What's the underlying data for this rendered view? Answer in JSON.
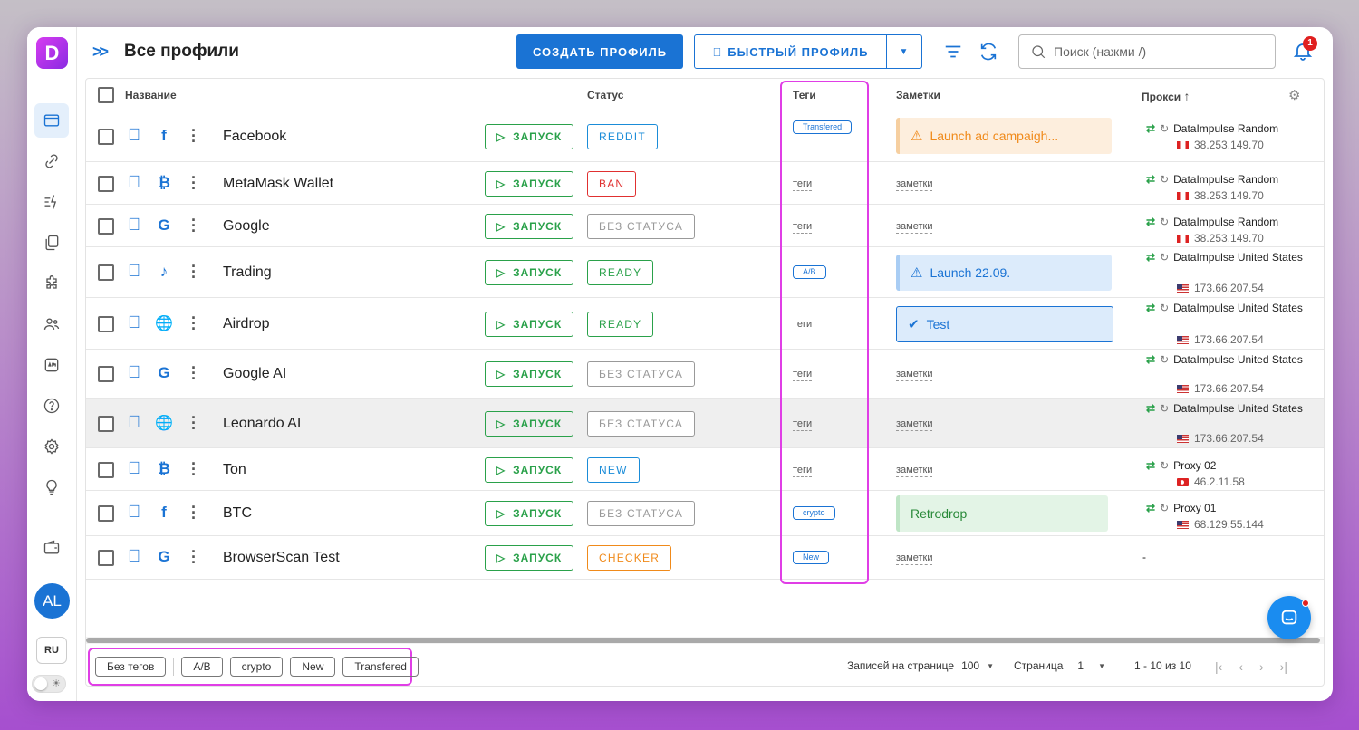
{
  "app": {
    "logo_letter": "D"
  },
  "header": {
    "title": "Все профили",
    "create_label": "СОЗДАТЬ ПРОФИЛЬ",
    "quick_label": "БЫСТРЫЙ ПРОФИЛЬ",
    "search_placeholder": "Поиск (нажми /)",
    "notif_count": "1"
  },
  "sidebar": {
    "avatar": "AL",
    "lang": "RU"
  },
  "columns": {
    "name": "Название",
    "status": "Статус",
    "tags": "Теги",
    "notes": "Заметки",
    "proxy": "Прокси"
  },
  "launch_label": "ЗАПУСК",
  "empty_tag": "теги",
  "empty_note": "заметки",
  "rows": [
    {
      "name": "Facebook",
      "site_icon": "facebook-icon",
      "status": "REDDIT",
      "tag": "Transfered",
      "note": "Launch ad campaigh...",
      "proxy": "DataImpulse Random",
      "ip": "38.253.149.70",
      "flag": "ca"
    },
    {
      "name": "MetaMask Wallet",
      "site_icon": "bitcoin-icon",
      "status": "BAN",
      "tag": "",
      "note": "",
      "proxy": "DataImpulse Random",
      "ip": "38.253.149.70",
      "flag": "ca"
    },
    {
      "name": "Google",
      "site_icon": "google-icon",
      "status": "БЕЗ СТАТУСА",
      "tag": "",
      "note": "",
      "proxy": "DataImpulse Random",
      "ip": "38.253.149.70",
      "flag": "ca"
    },
    {
      "name": "Trading",
      "site_icon": "tiktok-icon",
      "status": "READY",
      "tag": "A/B",
      "note": "Launch 22.09.",
      "proxy": "DataImpulse United States",
      "ip": "173.66.207.54",
      "flag": "us"
    },
    {
      "name": "Airdrop",
      "site_icon": "globe-icon",
      "status": "READY",
      "tag": "",
      "note": "Test",
      "proxy": "DataImpulse United States",
      "ip": "173.66.207.54",
      "flag": "us"
    },
    {
      "name": "Google AI",
      "site_icon": "google-icon",
      "status": "БЕЗ СТАТУСА",
      "tag": "",
      "note": "",
      "proxy": "DataImpulse United States",
      "ip": "173.66.207.54",
      "flag": "us"
    },
    {
      "name": "Leonardo AI",
      "site_icon": "globe-icon",
      "status": "БЕЗ СТАТУСА",
      "tag": "",
      "note": "",
      "proxy": "DataImpulse United States",
      "ip": "173.66.207.54",
      "flag": "us"
    },
    {
      "name": "Ton",
      "site_icon": "bitcoin-icon",
      "status": "NEW",
      "tag": "",
      "note": "",
      "proxy": "Proxy 02",
      "ip": "46.2.11.58",
      "flag": "tr"
    },
    {
      "name": "BTC",
      "site_icon": "facebook-icon",
      "status": "БЕЗ СТАТУСА",
      "tag": "crypto",
      "note": "Retrodrop",
      "proxy": "Proxy 01",
      "ip": "68.129.55.144",
      "flag": "us"
    },
    {
      "name": "BrowserScan Test",
      "site_icon": "google-icon",
      "status": "CHECKER",
      "tag": "New",
      "note": "",
      "proxy": "-",
      "ip": "",
      "flag": ""
    }
  ],
  "footer": {
    "tags": [
      "Без тегов",
      "A/B",
      "crypto",
      "New",
      "Transfered"
    ],
    "per_page_label": "Записей на странице",
    "per_page": "100",
    "page_label": "Страница",
    "page": "1",
    "range": "1 - 10 из 10"
  },
  "colors": {
    "accent": "#1a73d4",
    "green": "#2aa14a",
    "highlight": "#e03ee6"
  }
}
